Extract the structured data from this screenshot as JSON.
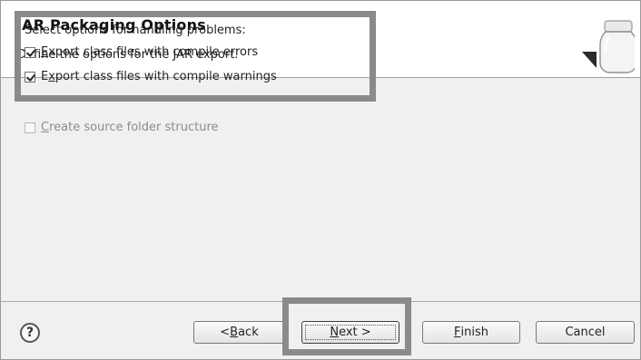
{
  "header": {
    "title": "JAR Packaging Options",
    "description": "Define the options for the JAR export."
  },
  "problems": {
    "label": "Select options for handling problems:",
    "options": [
      {
        "pre": "",
        "mnemonic": "E",
        "post": "xport class files with compile errors",
        "checked": true
      },
      {
        "pre": "E",
        "mnemonic": "x",
        "post": "port class files with compile warnings",
        "checked": true
      }
    ]
  },
  "source_folder": {
    "mnemonic": "C",
    "post": "reate source folder structure",
    "checked": false,
    "enabled": false
  },
  "buttons": {
    "help": "?",
    "back_pre": "< ",
    "back_mnemonic": "B",
    "back_post": "ack",
    "next_mnemonic": "N",
    "next_post": "ext >",
    "finish_mnemonic": "F",
    "finish_post": "inish",
    "cancel": "Cancel"
  },
  "icons": {
    "header_icon": "jar-icon",
    "help_icon": "help-icon"
  },
  "colors": {
    "highlight_border": "#8a8a8a",
    "header_bg": "#ffffff",
    "dialog_bg": "#f0f0f0"
  }
}
